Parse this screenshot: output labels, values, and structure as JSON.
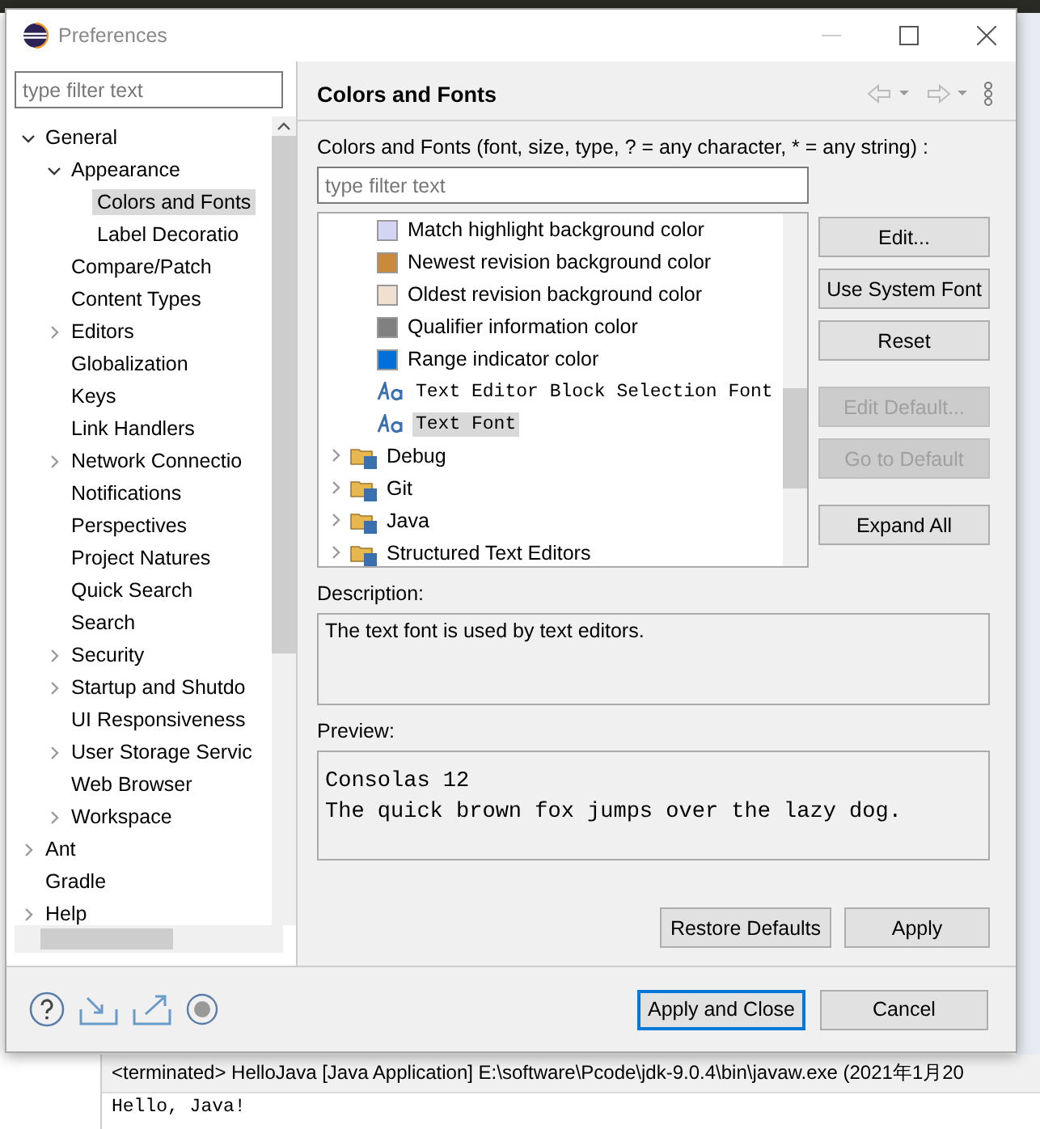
{
  "window": {
    "title": "Preferences"
  },
  "sidebar": {
    "filter": {
      "placeholder": "type filter text"
    },
    "items": [
      {
        "label": "General",
        "expanded": true,
        "selected": false,
        "children": [
          {
            "label": "Appearance",
            "expanded": true,
            "selected": false,
            "children": [
              {
                "label": "Colors and Fonts",
                "selected": true
              },
              {
                "label": "Label Decoratio",
                "selected": false
              }
            ]
          },
          {
            "label": "Compare/Patch",
            "selected": false
          },
          {
            "label": "Content Types",
            "selected": false
          },
          {
            "label": "Editors",
            "expanded": false,
            "selected": false
          },
          {
            "label": "Globalization",
            "selected": false
          },
          {
            "label": "Keys",
            "selected": false
          },
          {
            "label": "Link Handlers",
            "selected": false
          },
          {
            "label": "Network Connectio",
            "expanded": false,
            "selected": false
          },
          {
            "label": "Notifications",
            "selected": false
          },
          {
            "label": "Perspectives",
            "selected": false
          },
          {
            "label": "Project Natures",
            "selected": false
          },
          {
            "label": "Quick Search",
            "selected": false
          },
          {
            "label": "Search",
            "selected": false
          },
          {
            "label": "Security",
            "expanded": false,
            "selected": false
          },
          {
            "label": "Startup and Shutdo",
            "expanded": false,
            "selected": false
          },
          {
            "label": "UI Responsiveness",
            "selected": false
          },
          {
            "label": "User Storage Servic",
            "expanded": false,
            "selected": false
          },
          {
            "label": "Web Browser",
            "selected": false
          },
          {
            "label": "Workspace",
            "expanded": false,
            "selected": false
          }
        ]
      },
      {
        "label": "Ant",
        "expanded": false,
        "selected": false
      },
      {
        "label": "Gradle",
        "selected": false
      },
      {
        "label": "Help",
        "expanded": false,
        "selected": false
      }
    ]
  },
  "page": {
    "title": "Colors and Fonts",
    "filter_label": "Colors and Fonts (font, size, type, ? = any character, * = any string) :",
    "filter": {
      "placeholder": "type filter text"
    },
    "entries": [
      {
        "label": "Match highlight background color",
        "kind": "color",
        "color": "#d4d4f4",
        "selected": false
      },
      {
        "label": "Newest revision background color",
        "kind": "color",
        "color": "#c98a3c",
        "selected": false
      },
      {
        "label": "Oldest revision background color",
        "kind": "color",
        "color": "#f0e0d0",
        "selected": false
      },
      {
        "label": "Qualifier information color",
        "kind": "color",
        "color": "#808080",
        "selected": false
      },
      {
        "label": "Range indicator color",
        "kind": "color",
        "color": "#0070d8",
        "selected": false
      },
      {
        "label": "Text Editor Block Selection Font",
        "kind": "font",
        "selected": false
      },
      {
        "label": "Text Font",
        "kind": "font",
        "selected": true
      },
      {
        "label": "Debug",
        "kind": "category",
        "selected": false
      },
      {
        "label": "Git",
        "kind": "category",
        "selected": false
      },
      {
        "label": "Java",
        "kind": "category",
        "selected": false
      },
      {
        "label": "Structured Text Editors",
        "kind": "category",
        "selected": false
      }
    ],
    "buttons": [
      {
        "label": "Edit...",
        "disabled": false
      },
      {
        "label": "Use System Font",
        "disabled": false
      },
      {
        "label": "Reset",
        "disabled": false
      },
      {
        "label": "Edit Default...",
        "disabled": true
      },
      {
        "label": "Go to Default",
        "disabled": true
      },
      {
        "label": "Expand All",
        "disabled": false
      }
    ],
    "description_label": "Description:",
    "description": "The text font is used by text editors.",
    "preview_label": "Preview:",
    "preview": [
      "Consolas 12",
      "The quick brown fox jumps over the lazy dog."
    ],
    "restore_button": "Restore Defaults",
    "apply_button": "Apply"
  },
  "footer": {
    "buttons": [
      {
        "label": "Apply and Close",
        "selected": true
      },
      {
        "label": "Cancel",
        "selected": false
      }
    ]
  },
  "console": {
    "header": "<terminated> HelloJava [Java Application] E:\\software\\Pcode\\jdk-9.0.4\\bin\\javaw.exe  (2021年1月20",
    "lines": [
      "Hello, Java!"
    ]
  }
}
